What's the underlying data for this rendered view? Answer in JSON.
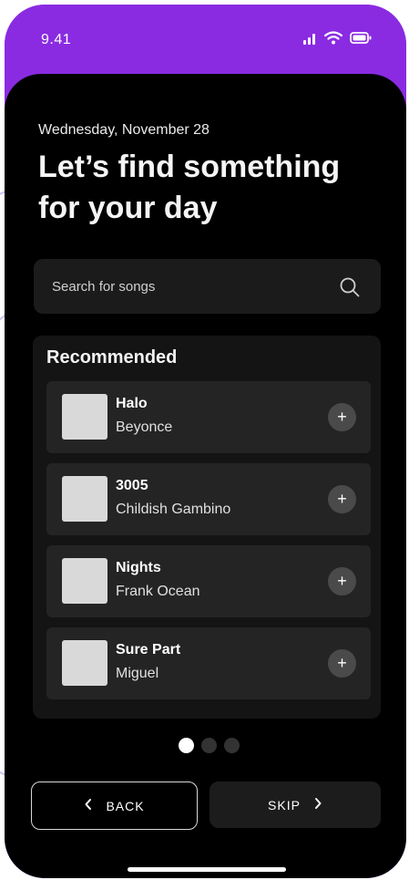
{
  "status_bar": {
    "time": "9.41"
  },
  "header": {
    "date": "Wednesday,  November 28",
    "title": "Let’s find something for your day"
  },
  "search": {
    "placeholder": "Search for songs"
  },
  "recommended": {
    "title": "Recommended",
    "songs": [
      {
        "name": "Halo",
        "artist": "Beyonce"
      },
      {
        "name": "3005",
        "artist": "Childish Gambino"
      },
      {
        "name": "Nights",
        "artist": "Frank Ocean"
      },
      {
        "name": "Sure Part",
        "artist": "Miguel"
      }
    ],
    "add_glyph": "+"
  },
  "pagination": {
    "total": 3,
    "active": 1
  },
  "buttons": {
    "back_label": "BACK",
    "skip_label": "SKIP"
  },
  "colors": {
    "accent": "#8a2be2",
    "background": "#000000",
    "card": "#141414",
    "song_row": "#242424"
  }
}
